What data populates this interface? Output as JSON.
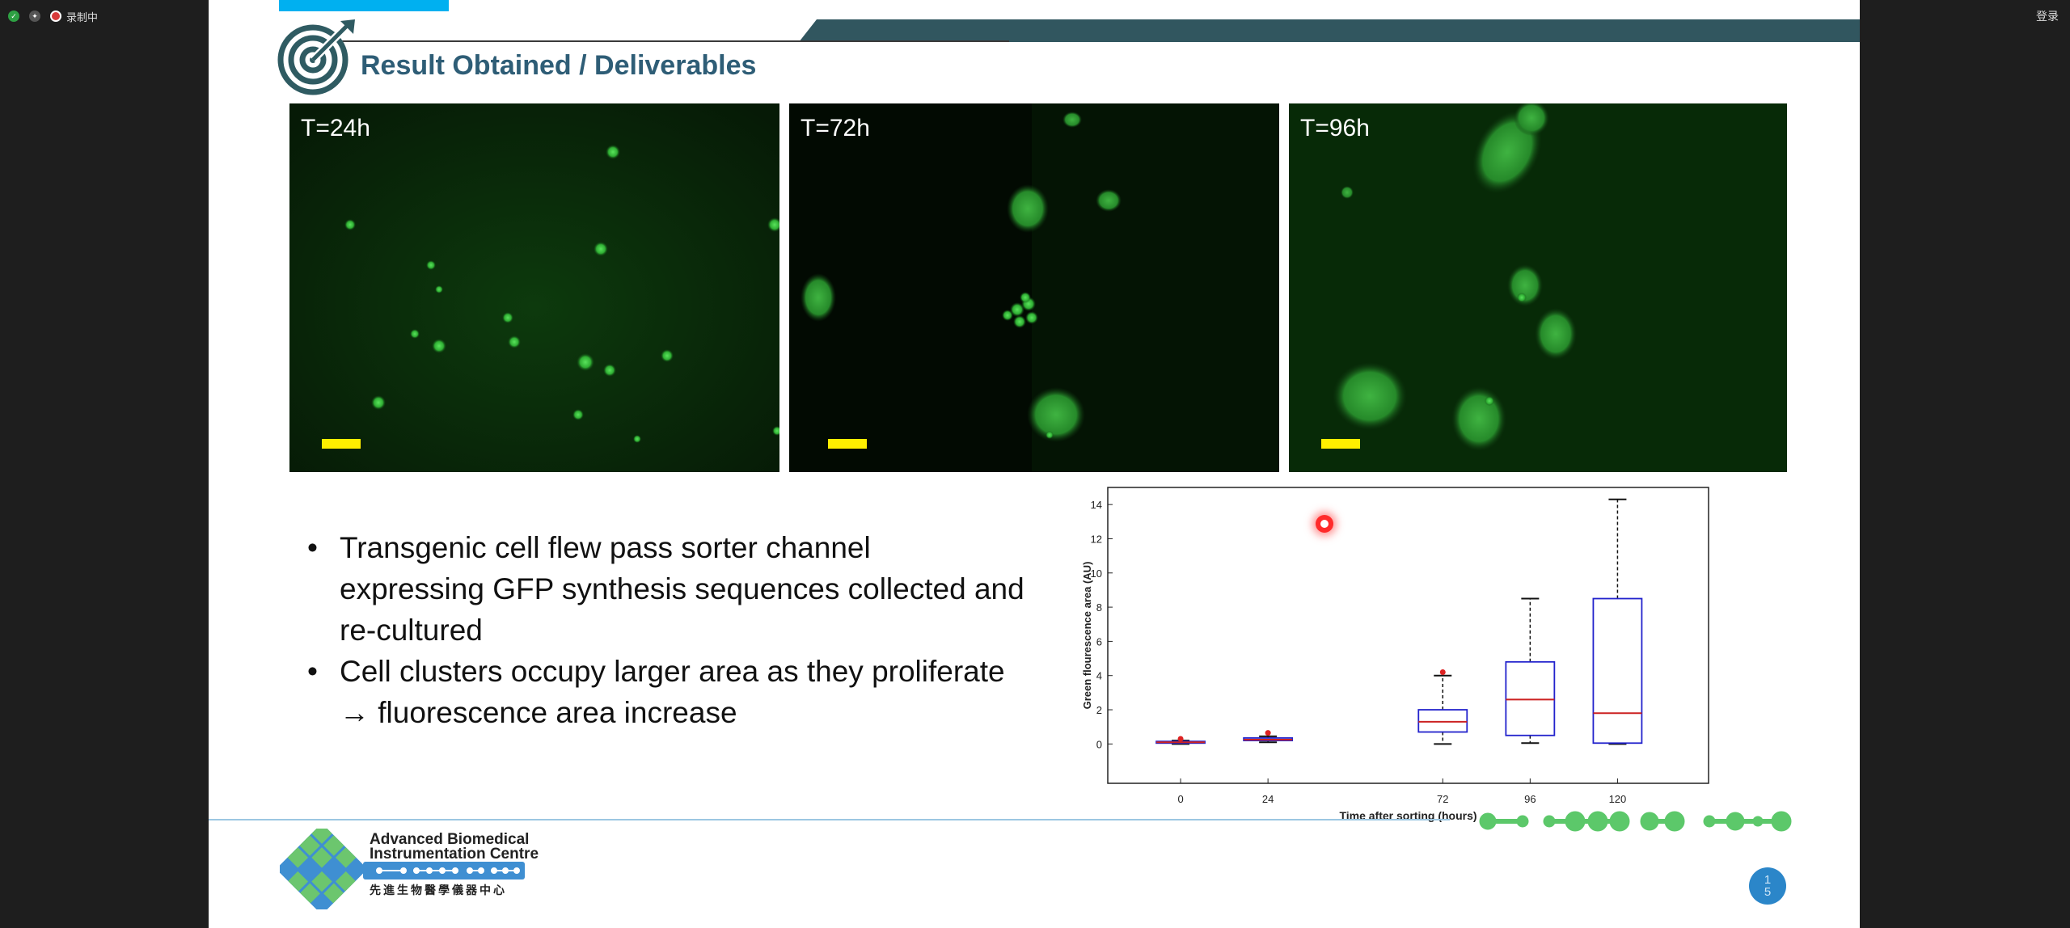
{
  "topbar": {
    "indicators": [
      "shield-check-icon",
      "pin-icon"
    ],
    "recording_label": "录制中",
    "login_label": "登录"
  },
  "slide": {
    "title": "Result Obtained / Deliverables",
    "panels": [
      {
        "label": "T=24h"
      },
      {
        "label": "T=72h"
      },
      {
        "label": "T=96h"
      }
    ],
    "bullets": [
      "Transgenic cell flew pass sorter channel expressing GFP synthesis sequences collected and re-cultured",
      "Cell clusters occupy larger area as they proliferate → fluorescence area increase"
    ],
    "bullet_lines": [
      [
        "Transgenic cell flew pass sorter channel",
        "expressing GFP synthesis sequences collected and",
        "re-cultured"
      ],
      [
        "Cell clusters occupy larger area as they proliferate",
        "→ fluorescence area increase"
      ]
    ],
    "logo": {
      "line1": "Advanced Biomedical",
      "line2": "Instrumentation Centre",
      "line3": "先進生物醫學儀器中心"
    },
    "page_number": [
      "1",
      "5"
    ]
  },
  "chart_data": {
    "type": "box",
    "xlabel": "Time after sorting (hours)",
    "ylabel": "Green flourescence area (AU)",
    "x": [
      0,
      24,
      72,
      96,
      120
    ],
    "xlim": [
      -20,
      145
    ],
    "ylim": [
      -2.3,
      15
    ],
    "yticks": [
      0,
      2,
      4,
      6,
      8,
      10,
      12,
      14
    ],
    "boxes": [
      {
        "x": 0,
        "q1": 0.05,
        "median": 0.1,
        "q3": 0.15,
        "whisker_low": 0.0,
        "whisker_high": 0.2,
        "outliers": [
          0.3
        ]
      },
      {
        "x": 24,
        "q1": 0.2,
        "median": 0.25,
        "q3": 0.35,
        "whisker_low": 0.1,
        "whisker_high": 0.45,
        "outliers": [
          0.65
        ]
      },
      {
        "x": 72,
        "q1": 0.7,
        "median": 1.3,
        "q3": 2.0,
        "whisker_low": 0.0,
        "whisker_high": 4.0,
        "outliers": [
          4.2
        ]
      },
      {
        "x": 96,
        "q1": 0.5,
        "median": 2.6,
        "q3": 4.8,
        "whisker_low": 0.05,
        "whisker_high": 8.5,
        "outliers": []
      },
      {
        "x": 120,
        "q1": 0.05,
        "median": 1.8,
        "q3": 8.5,
        "whisker_low": 0.0,
        "whisker_high": 14.3,
        "outliers": []
      }
    ],
    "colors": {
      "box": "#2222cc",
      "median": "#cc2222",
      "outlier": "#dd2222",
      "whisker": "#111111"
    }
  }
}
